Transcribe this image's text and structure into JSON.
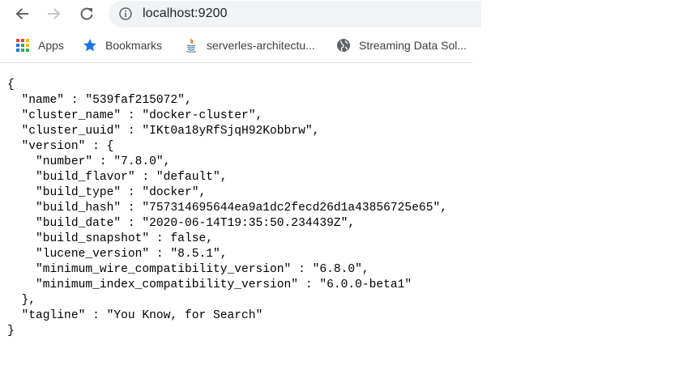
{
  "browser": {
    "url": "localhost:9200",
    "icons": {
      "back": "arrow-left-icon",
      "forward": "arrow-right-icon",
      "reload": "reload-icon",
      "site_info": "info-circle-icon"
    }
  },
  "bookmarks": [
    {
      "label": "Apps",
      "icon": "apps-grid-icon"
    },
    {
      "label": "Bookmarks",
      "icon": "star-icon"
    },
    {
      "label": "serverles-architectu...",
      "icon": "java-icon"
    },
    {
      "label": "Streaming Data Sol...",
      "icon": "globe-icon"
    }
  ],
  "content": {
    "lines": [
      "{",
      "  \"name\" : \"539faf215072\",",
      "  \"cluster_name\" : \"docker-cluster\",",
      "  \"cluster_uuid\" : \"IKt0a18yRfSjqH92Kobbrw\",",
      "  \"version\" : {",
      "    \"number\" : \"7.8.0\",",
      "    \"build_flavor\" : \"default\",",
      "    \"build_type\" : \"docker\",",
      "    \"build_hash\" : \"757314695644ea9a1dc2fecd26d1a43856725e65\",",
      "    \"build_date\" : \"2020-06-14T19:35:50.234439Z\",",
      "    \"build_snapshot\" : false,",
      "    \"lucene_version\" : \"8.5.1\",",
      "    \"minimum_wire_compatibility_version\" : \"6.8.0\",",
      "    \"minimum_index_compatibility_version\" : \"6.0.0-beta1\"",
      "  },",
      "  \"tagline\" : \"You Know, for Search\"",
      "}"
    ]
  },
  "colors": {
    "omnibox_bg": "#f1f3f4",
    "bookmark_star": "#1a73e8",
    "toolbar_icon": "#5f6368",
    "forward_disabled": "#c4c7c5"
  }
}
